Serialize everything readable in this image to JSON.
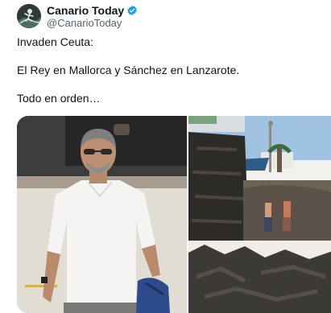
{
  "account": {
    "display_name": "Canario Today",
    "handle": "@CanarioToday",
    "avatar": "surfer-avatar-icon",
    "verified_badge": "verified-badge-icon",
    "verified_color": "#1d9bf0"
  },
  "tweet": {
    "lines": [
      "Invaden Ceuta:",
      "El Rey en Mallorca y Sánchez en Lanzarote.",
      "Todo en orden…"
    ]
  },
  "media": {
    "photos": [
      {
        "subject": "man-in-white-polo-photo"
      },
      {
        "subject": "volcanic-coast-photo"
      }
    ]
  }
}
